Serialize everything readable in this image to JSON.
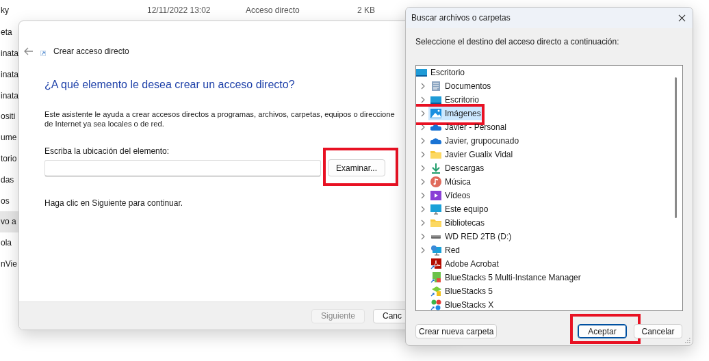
{
  "explorer": {
    "rows": [
      {
        "name": "ky",
        "date": "12/11/2022 13:02",
        "type": "Acceso directo",
        "size": "2 KB",
        "selected": false
      },
      {
        "name": "eta",
        "selected": false
      },
      {
        "name": "inata",
        "selected": false
      },
      {
        "name": "inata",
        "selected": false
      },
      {
        "name": "inata",
        "selected": false
      },
      {
        "name": "ositi",
        "selected": false
      },
      {
        "name": "ume",
        "selected": false
      },
      {
        "name": "torio",
        "selected": false
      },
      {
        "name": "das",
        "selected": false
      },
      {
        "name": "os",
        "selected": false
      },
      {
        "name": "vo a",
        "selected": true
      },
      {
        "name": "ola",
        "selected": false
      },
      {
        "name": "nVie",
        "selected": false
      }
    ]
  },
  "wizard": {
    "title": "Crear acceso directo",
    "heading": "¿A qué elemento le desea crear un acceso directo?",
    "intro": "Este asistente le ayuda a crear accesos directos a programas, archivos, carpetas, equipos o direccione\nde Internet ya sea locales o de red.",
    "field_label": "Escriba la ubicación del elemento:",
    "browse_button": {
      "label": "Examinar...",
      "highlighted": true
    },
    "hint": "Haga clic en Siguiente para continuar.",
    "buttons": [
      {
        "label": "Siguiente",
        "disabled": true
      },
      {
        "label": "Canc",
        "disabled": false
      }
    ]
  },
  "browse_dialog": {
    "title": "Buscar archivos o carpetas",
    "prompt": "Seleccione el destino del acceso directo a continuación:",
    "tree": {
      "label": "Escritorio",
      "kind": "desktop",
      "selected": false,
      "children": [
        {
          "label": "Documentos",
          "kind": "documents",
          "expandable": true,
          "selected": false,
          "highlighted": false
        },
        {
          "label": "Escritorio",
          "kind": "desktop",
          "expandable": true,
          "selected": false,
          "highlighted": false
        },
        {
          "label": "Imágenes",
          "kind": "pictures",
          "expandable": true,
          "selected": true,
          "highlighted": true
        },
        {
          "label": "Javier - Personal",
          "kind": "cloud",
          "expandable": true,
          "selected": false,
          "highlighted": false
        },
        {
          "label": "Javier, grupocunado",
          "kind": "cloud",
          "expandable": true,
          "selected": false,
          "highlighted": false
        },
        {
          "label": "Javier Gualix Vidal",
          "kind": "folder",
          "expandable": true,
          "selected": false,
          "highlighted": false
        },
        {
          "label": "Descargas",
          "kind": "download",
          "expandable": true,
          "selected": false,
          "highlighted": false
        },
        {
          "label": "Música",
          "kind": "music",
          "expandable": true,
          "selected": false,
          "highlighted": false
        },
        {
          "label": "Vídeos",
          "kind": "video",
          "expandable": true,
          "selected": false,
          "highlighted": false
        },
        {
          "label": "Este equipo",
          "kind": "computer",
          "expandable": true,
          "selected": false,
          "highlighted": false
        },
        {
          "label": "Bibliotecas",
          "kind": "folder",
          "expandable": true,
          "selected": false,
          "highlighted": false
        },
        {
          "label": "WD RED 2TB (D:)",
          "kind": "drive",
          "expandable": true,
          "selected": false,
          "highlighted": false
        },
        {
          "label": "Red",
          "kind": "network",
          "expandable": true,
          "selected": false,
          "highlighted": false
        },
        {
          "label": "Adobe Acrobat",
          "kind": "app-red",
          "expandable": false,
          "selected": false,
          "highlighted": false
        },
        {
          "label": "BlueStacks 5 Multi-Instance Manager",
          "kind": "app-green",
          "expandable": false,
          "selected": false,
          "highlighted": false
        },
        {
          "label": "BlueStacks 5",
          "kind": "app-stack",
          "expandable": false,
          "selected": false,
          "highlighted": false
        },
        {
          "label": "BlueStacks X",
          "kind": "app-x",
          "expandable": false,
          "selected": false,
          "highlighted": false
        }
      ]
    },
    "buttons": [
      {
        "label": "Crear nueva carpeta",
        "kind": "left",
        "default": false
      },
      {
        "label": "Aceptar",
        "kind": "right",
        "default": true,
        "highlighted": true
      },
      {
        "label": "Cancelar",
        "kind": "right",
        "default": false,
        "highlighted": false
      }
    ]
  }
}
